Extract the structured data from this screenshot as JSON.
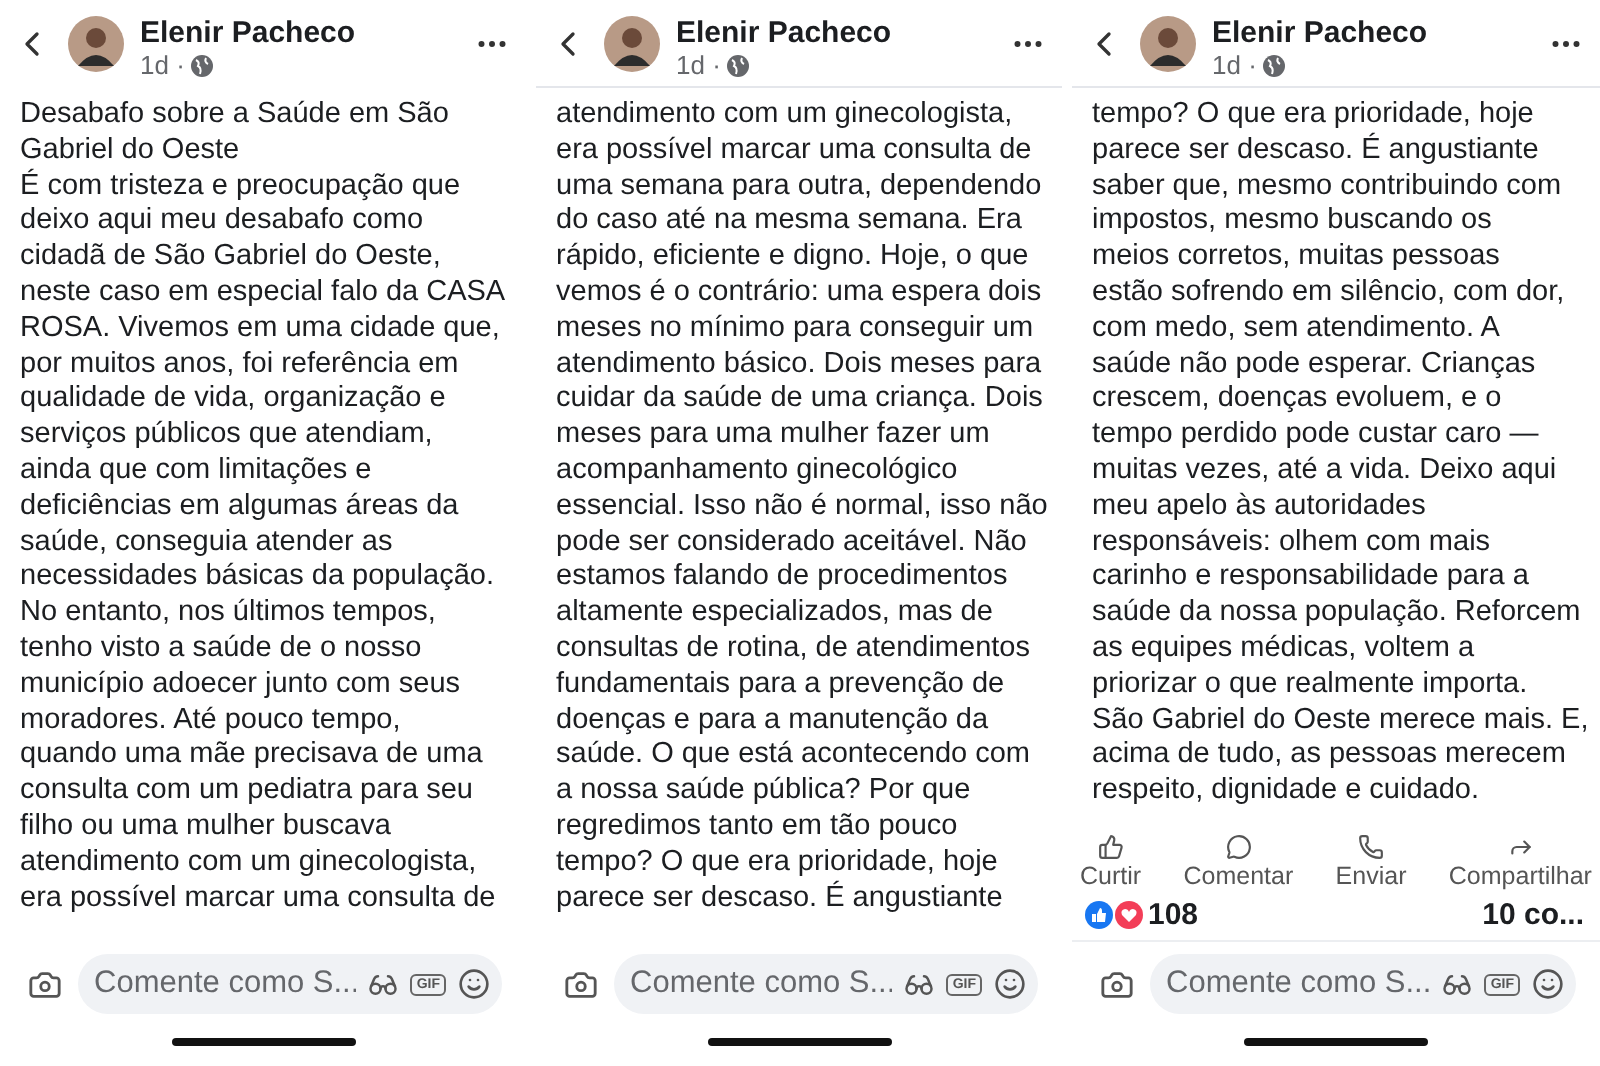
{
  "panels": [
    {
      "author": "Elenir Pacheco",
      "time": "1d ·",
      "header_divider": false,
      "lines": [
        "Desabafo sobre a Saúde em São",
        "Gabriel do Oeste",
        "É com tristeza e preocupação que",
        "deixo aqui meu desabafo como",
        "cidadã de São Gabriel do Oeste,",
        "neste caso em especial falo da CASA",
        "ROSA. Vivemos em uma cidade que,",
        "por muitos anos, foi referência em",
        "qualidade de vida, organização e",
        "serviços públicos que atendiam,",
        "ainda que com limitações e",
        "deficiências em algumas áreas da",
        "saúde, conseguia atender as",
        "necessidades básicas da população.",
        "No entanto, nos últimos tempos,",
        "tenho visto a saúde de o nosso",
        "município adoecer junto com seus",
        "moradores. Até pouco tempo,",
        "quando uma mãe precisava de uma",
        "consulta com um pediatra para seu",
        "filho ou uma mulher buscava",
        "atendimento com um ginecologista,",
        "era possível marcar uma consulta de"
      ],
      "comment": {
        "placeholder": "Comente como S...",
        "gif": "GIF"
      }
    },
    {
      "author": "Elenir Pacheco",
      "time": "1d ·",
      "header_divider": true,
      "lines": [
        "atendimento com um ginecologista,",
        "era possível marcar uma consulta de",
        "uma semana para outra, dependendo",
        "do caso até na mesma semana. Era",
        "rápido, eficiente e digno. Hoje, o que",
        "vemos é o contrário: uma espera dois",
        "meses no mínimo para conseguir um",
        "atendimento básico. Dois meses para",
        "cuidar da saúde de uma criança. Dois",
        "meses para uma mulher fazer um",
        "acompanhamento ginecológico",
        "essencial. Isso não é normal, isso não",
        "pode ser considerado aceitável. Não",
        "estamos falando de procedimentos",
        "altamente especializados, mas de",
        "consultas de rotina, de atendimentos",
        "fundamentais para a prevenção de",
        "doenças e para a manutenção da",
        "saúde. O que está acontecendo com",
        "a nossa saúde pública? Por que",
        "regredimos tanto em tão pouco",
        "tempo? O que era prioridade, hoje",
        "parece ser descaso. É angustiante"
      ],
      "comment": {
        "placeholder": "Comente como S...",
        "gif": "GIF"
      }
    },
    {
      "author": "Elenir Pacheco",
      "time": "1d ·",
      "header_divider": true,
      "lines": [
        "tempo? O que era prioridade, hoje",
        "parece ser descaso. É angustiante",
        "saber que, mesmo contribuindo com",
        "impostos, mesmo buscando os",
        "meios corretos, muitas pessoas",
        "estão sofrendo em silêncio, com dor,",
        "com medo, sem atendimento. A",
        "saúde não pode esperar. Crianças",
        "crescem, doenças evoluem, e o",
        "tempo perdido pode custar caro —",
        "muitas vezes, até a vida. Deixo aqui",
        "meu apelo às autoridades",
        "responsáveis: olhem com mais",
        "carinho e responsabilidade para a",
        "saúde da nossa população. Reforcem",
        "as equipes médicas, voltem a",
        "priorizar o que realmente importa.",
        "São Gabriel do Oeste merece mais. E,",
        "acima de tudo, as pessoas merecem",
        "respeito, dignidade e cuidado."
      ],
      "actions": [
        {
          "kind": "like",
          "label": "Curtir"
        },
        {
          "kind": "comment",
          "label": "Comentar"
        },
        {
          "kind": "send",
          "label": "Enviar"
        },
        {
          "kind": "share",
          "label": "Compartilhar"
        }
      ],
      "reactions": {
        "count": "108",
        "comments": "10 co..."
      },
      "comment": {
        "placeholder": "Comente como S...",
        "gif": "GIF"
      }
    }
  ]
}
